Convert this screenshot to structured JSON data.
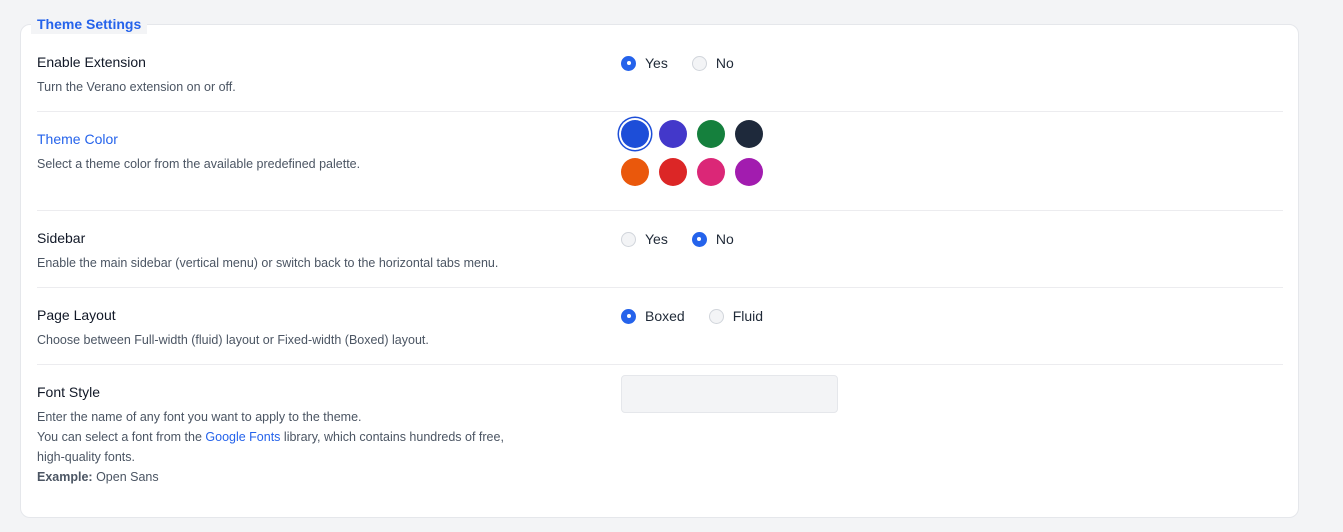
{
  "legend": "Theme Settings",
  "enable_extension": {
    "label": "Enable Extension",
    "description": "Turn the Verano extension on or off.",
    "options": [
      {
        "label": "Yes",
        "selected": true
      },
      {
        "label": "No",
        "selected": false
      }
    ]
  },
  "theme_color": {
    "label": "Theme Color",
    "description": "Select a theme color from the available predefined palette.",
    "selected_index": 0,
    "colors": [
      "#1d4ed8",
      "#4338ca",
      "#15803d",
      "#1e293b",
      "#ea580c",
      "#dc2626",
      "#db2777",
      "#a21caf"
    ]
  },
  "sidebar": {
    "label": "Sidebar",
    "description": "Enable the main sidebar (vertical menu) or switch back to the horizontal tabs menu.",
    "options": [
      {
        "label": "Yes",
        "selected": false
      },
      {
        "label": "No",
        "selected": true
      }
    ]
  },
  "page_layout": {
    "label": "Page Layout",
    "description": "Choose between Full-width (fluid) layout or Fixed-width (Boxed) layout.",
    "options": [
      {
        "label": "Boxed",
        "selected": true
      },
      {
        "label": "Fluid",
        "selected": false
      }
    ]
  },
  "font_style": {
    "label": "Font Style",
    "line1": "Enter the name of any font you want to apply to the theme.",
    "line2_pre": "You can select a font from the ",
    "link": "Google Fonts",
    "line2_post": " library, which contains hundreds of free,",
    "line3": "high-quality fonts.",
    "example_label": "Example:",
    "example_value": " Open Sans",
    "value": "",
    "placeholder": ""
  },
  "colors": {
    "accent": "#2563eb"
  }
}
